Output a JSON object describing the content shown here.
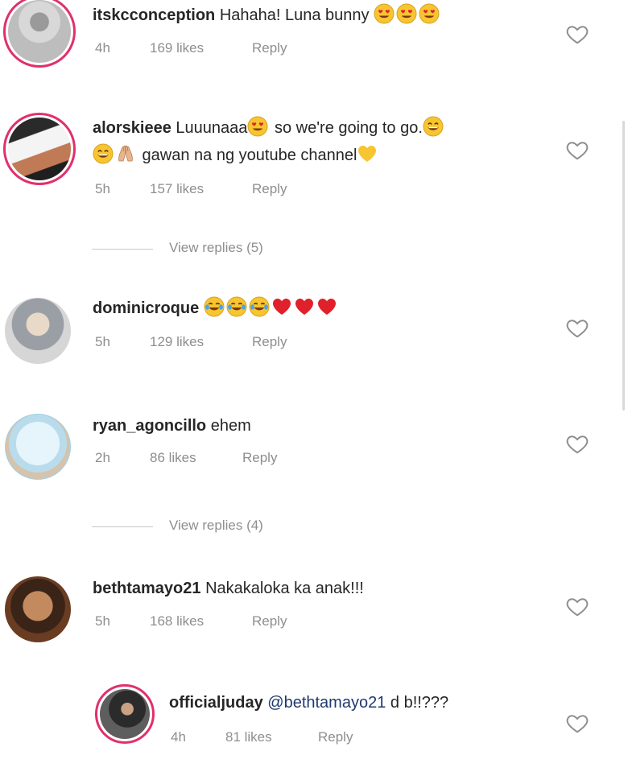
{
  "comments": [
    {
      "username": "itskcconception",
      "text": "Hahaha! Luna bunny",
      "emojis_after": [
        "heart-eyes",
        "heart-eyes",
        "heart-eyes"
      ],
      "time": "4h",
      "likes": "169 likes",
      "reply": "Reply"
    },
    {
      "username": "alorskieee",
      "text": "Luuunaaa",
      "text2": " so we're going to go.",
      "text3": " gawan na ng youtube channel",
      "time": "5h",
      "likes": "157 likes",
      "reply": "Reply",
      "view_replies": "View replies (5)"
    },
    {
      "username": "dominicroque",
      "text": "",
      "time": "5h",
      "likes": "129 likes",
      "reply": "Reply"
    },
    {
      "username": "ryan_agoncillo",
      "text": "ehem",
      "time": "2h",
      "likes": "86 likes",
      "reply": "Reply",
      "view_replies": "View replies (4)"
    },
    {
      "username": "bethtamayo21",
      "text": "Nakakaloka ka anak!!!",
      "time": "5h",
      "likes": "168 likes",
      "reply": "Reply"
    },
    {
      "username": "officialjuday",
      "mention": "@bethtamayo21",
      "text": " d b!!???",
      "time": "4h",
      "likes": "81 likes",
      "reply": "Reply"
    }
  ],
  "colors": {
    "story_ring": "#e1306c",
    "meta_text": "#8e8e8e",
    "mention": "#1e3a6e",
    "heart_emoji": "#e0202a",
    "emoji_yellow": "#f7c531"
  }
}
